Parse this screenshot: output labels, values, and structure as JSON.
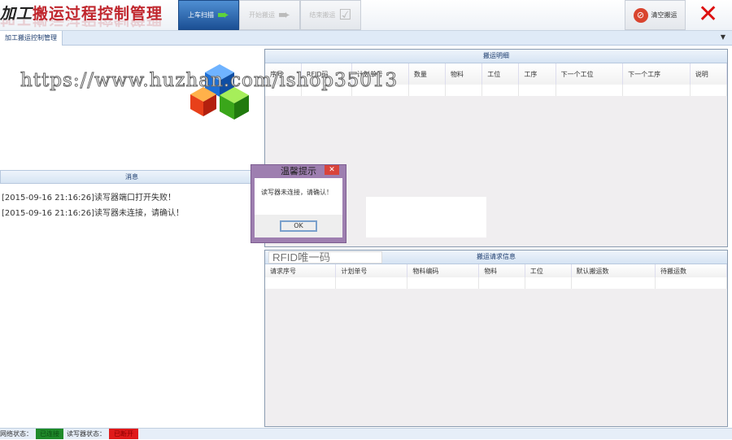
{
  "header": {
    "title_prefix": "加工",
    "title_main": "搬运过程控制管理",
    "buttons": [
      {
        "label": "上车扫描",
        "state": "active"
      },
      {
        "label": "开始搬运",
        "state": "disabled"
      },
      {
        "label": "结束搬运",
        "state": "disabled"
      }
    ],
    "clear_label": "清空搬运",
    "close_symbol": "✕"
  },
  "tab": {
    "label": "加工搬运控制管理"
  },
  "messages": {
    "title": "消息",
    "items": [
      "[2015-09-16 21:16:26]读写器端口打开失败！",
      "[2015-09-16 21:16:26]读写器未连接，请确认！"
    ]
  },
  "detail": {
    "title": "搬运明细",
    "columns": [
      "序号",
      "RFID码",
      "计划单号",
      "数量",
      "物料",
      "工位",
      "工序",
      "下一个工位",
      "下一个工序",
      "说明"
    ]
  },
  "request": {
    "title": "搬运请求信息",
    "rfid_placeholder": "RFID唯一码",
    "columns": [
      "请求序号",
      "计划单号",
      "物料编码",
      "物料",
      "工位",
      "默认搬运数",
      "待搬运数"
    ]
  },
  "dialog": {
    "title": "温馨提示",
    "message": "读写器未连接，请确认！",
    "ok": "OK"
  },
  "status": {
    "network_label": "网络状态：",
    "network_value": "已连接",
    "reader_label": "读写器状态：",
    "reader_value": "已断开",
    "ok_color": "#1f8a2a",
    "bad_color": "#e01a1a"
  },
  "watermark": "https://www.huzhan.com/ishop35013"
}
